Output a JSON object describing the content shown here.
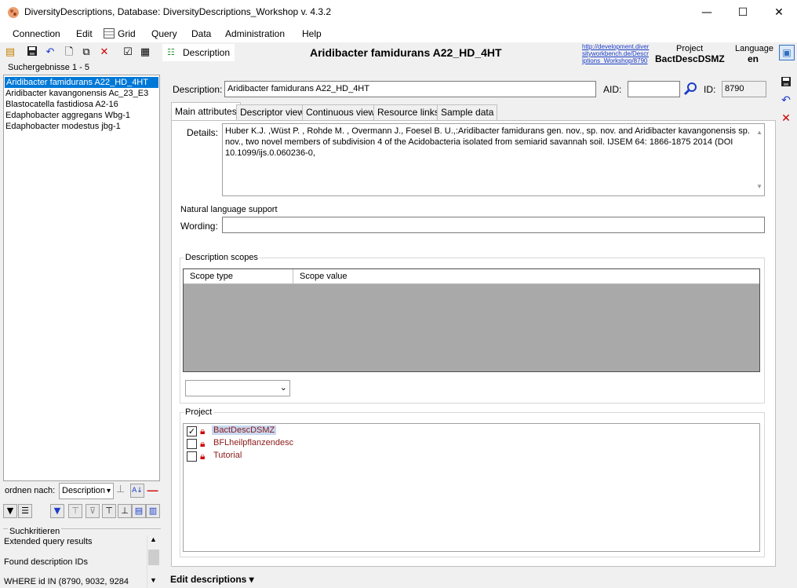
{
  "window": {
    "title": "DiversityDescriptions,  Database: DiversityDescriptions_Workshop    v. 4.3.2",
    "minimize": "—",
    "maximize": "☐",
    "close": "✕"
  },
  "menu": [
    "Connection",
    "Edit",
    "Grid",
    "Query",
    "Data",
    "Administration",
    "Help"
  ],
  "toolbar": {
    "description_tab": "Description",
    "record_title": "Aridibacter famidurans A22_HD_4HT",
    "url": "http://development.diversityworkbench.de/Descriptions_Workshop/8790",
    "project_label": "Project",
    "project_value": "BactDescDSMZ",
    "language_label": "Language",
    "language_value": "en"
  },
  "left": {
    "results_label": "Suchergebnisse   1 - 5",
    "items": [
      "Aridibacter famidurans A22_HD_4HT",
      "Aridibacter kavangonensis Ac_23_E3",
      "Blastocatella fastidiosa A2-16",
      "Edaphobacter aggregans Wbg-1",
      "Edaphobacter modestus jbg-1"
    ],
    "order_label": "ordnen nach:",
    "order_value": "Description",
    "criteria_title": "Suchkritieren",
    "criteria": [
      "Extended query results",
      "Found description IDs",
      "WHERE id IN (8790, 9032, 9284"
    ]
  },
  "form": {
    "description_label": "Description:",
    "description_value": "Aridibacter famidurans A22_HD_4HT",
    "aid_label": "AID:",
    "aid_value": "",
    "id_label": "ID:",
    "id_value": "8790",
    "tabs": [
      "Main attributes",
      "Descriptor view",
      "Continuous view",
      "Resource links",
      "Sample data"
    ],
    "details_label": "Details:",
    "details_value": "Huber K.J. ,Wüst P. , Rohde M. , Overmann J., Foesel B. U.,:Aridibacter famidurans gen. nov., sp. nov. and Aridibacter kavangonensis sp. nov., two novel members of subdivision 4 of the Acidobacteria isolated from semiarid savannah soil. IJSEM 64: 1866-1875 2014 (DOI 10.1099/ijs.0.060236-0,",
    "nls_label": "Natural language support",
    "wording_label": "Wording:",
    "wording_value": "",
    "scopes_title": "Description scopes",
    "scope_cols": [
      "Scope type",
      "Scope value"
    ],
    "project_title": "Project",
    "projects": [
      {
        "name": "BactDescDSMZ",
        "checked": true
      },
      {
        "name": "BFLheilpflanzendesc",
        "checked": false
      },
      {
        "name": "Tutorial",
        "checked": false
      }
    ]
  },
  "status": {
    "edit_label": "Edit descriptions ▾"
  }
}
